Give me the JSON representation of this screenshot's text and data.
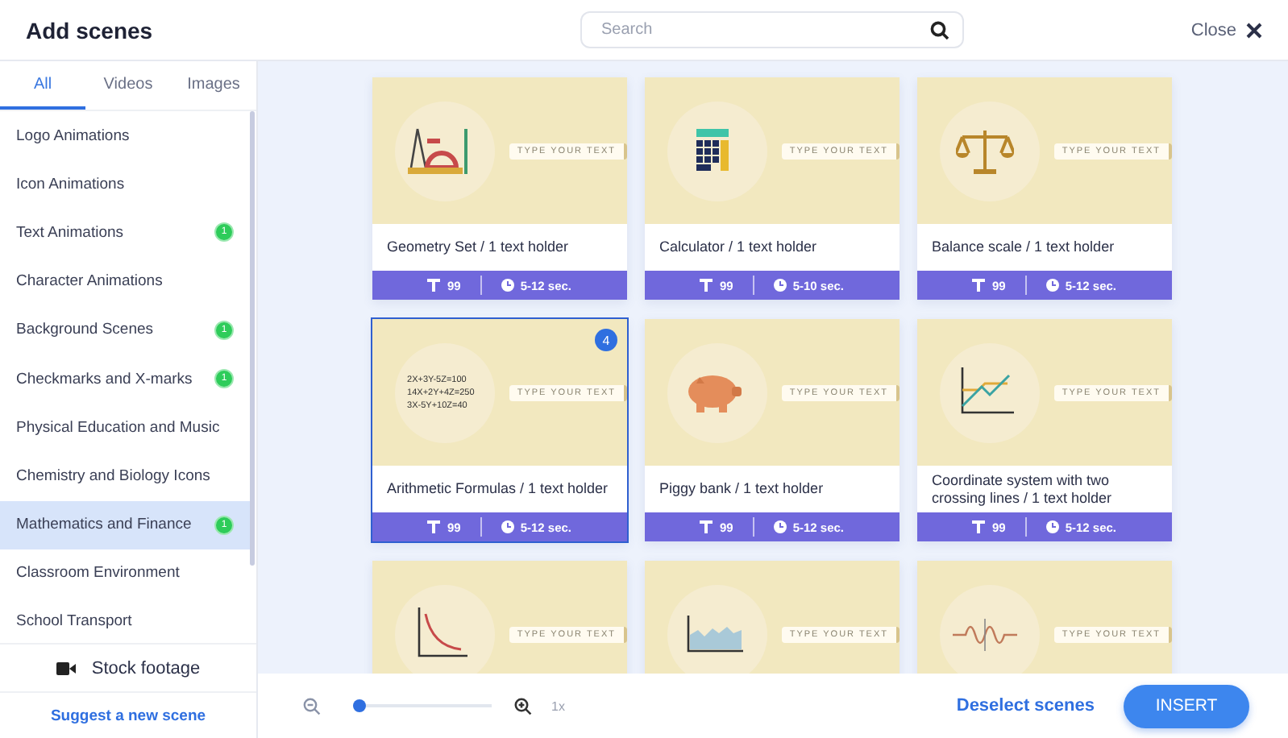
{
  "header": {
    "title": "Add scenes",
    "search": {
      "placeholder": "Search"
    },
    "close": "Close"
  },
  "sidebar": {
    "tabs": [
      {
        "label": "All",
        "selected": true
      },
      {
        "label": "Videos",
        "selected": false
      },
      {
        "label": "Images",
        "selected": false
      }
    ],
    "items": [
      {
        "label": "Logo Animations",
        "selected": false
      },
      {
        "label": "Icon Animations",
        "selected": false
      },
      {
        "label": "Text Animations",
        "selected": false,
        "badge": "1"
      },
      {
        "label": "Character Animations",
        "selected": false
      },
      {
        "label": "Background Scenes",
        "selected": false,
        "badge": "1"
      },
      {
        "label": "Checkmarks and X-marks",
        "selected": false,
        "badge": "1"
      },
      {
        "label": "Physical Education and Music",
        "selected": false
      },
      {
        "label": "Chemistry and Biology Icons",
        "selected": false
      },
      {
        "label": "Mathematics and Finance",
        "selected": true,
        "badge": "1"
      },
      {
        "label": "Classroom Environment",
        "selected": false
      },
      {
        "label": "School Transport",
        "selected": false
      }
    ],
    "stock_footage": "Stock footage",
    "suggest": "Suggest a new scene"
  },
  "cards": [
    {
      "kind": "geometry",
      "placeholder": "TYPE YOUR TEXT",
      "title": "Geometry Set / 1 text holder",
      "text_count": "99",
      "duration": "5-12 sec.",
      "selected": false
    },
    {
      "kind": "calculator",
      "placeholder": "TYPE YOUR TEXT",
      "title": "Calculator / 1 text holder",
      "text_count": "99",
      "duration": "5-10 sec.",
      "selected": false
    },
    {
      "kind": "scale",
      "placeholder": "TYPE YOUR TEXT",
      "title": "Balance scale / 1 text holder",
      "text_count": "99",
      "duration": "5-12 sec.",
      "selected": false
    },
    {
      "kind": "formulas",
      "formulas": [
        "2X+3Y-5Z=100",
        "14X+2Y+4Z=250",
        "3X-5Y+10Z=40"
      ],
      "placeholder": "TYPE YOUR TEXT",
      "title": "Arithmetic Formulas / 1 text holder",
      "text_count": "99",
      "duration": "5-12 sec.",
      "selected": true,
      "badge": "4"
    },
    {
      "kind": "piggy",
      "placeholder": "TYPE YOUR TEXT",
      "title": "Piggy bank / 1 text holder",
      "text_count": "99",
      "duration": "5-12 sec.",
      "selected": false
    },
    {
      "kind": "coordinate",
      "placeholder": "TYPE YOUR TEXT",
      "title": "Coordinate system with two crossing lines / 1 text holder",
      "text_count": "99",
      "duration": "5-12 sec.",
      "selected": false
    },
    {
      "kind": "decay",
      "placeholder": "TYPE YOUR TEXT",
      "selected": false
    },
    {
      "kind": "area",
      "placeholder": "TYPE YOUR TEXT",
      "selected": false
    },
    {
      "kind": "wave",
      "placeholder": "TYPE YOUR TEXT",
      "selected": false
    }
  ],
  "footer": {
    "zoom": {
      "level": 0,
      "reading": "1x"
    },
    "deselect": "Deselect scenes",
    "insert": "INSERT"
  }
}
